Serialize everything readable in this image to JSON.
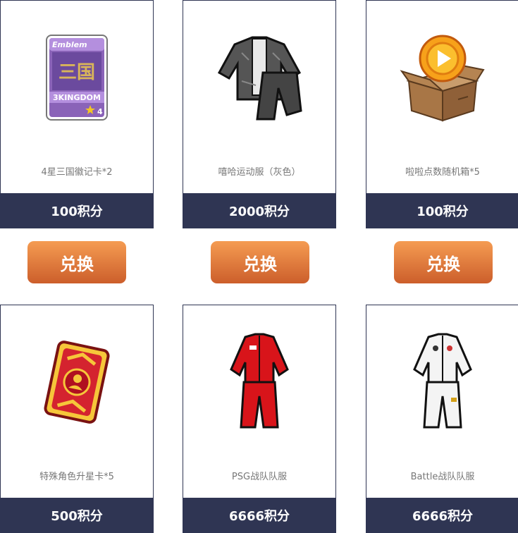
{
  "items": [
    {
      "name": "4星三国徽记卡*2",
      "price": "100积分",
      "icon": "emblem-card-icon",
      "card_text": {
        "top": "Emblem",
        "center": "三国",
        "bottom": "3KINGDOM",
        "stars": "4"
      }
    },
    {
      "name": "嘻哈运动服（灰色）",
      "price": "2000积分",
      "icon": "gray-tracksuit-icon"
    },
    {
      "name": "啦啦点数随机箱*5",
      "price": "100积分",
      "icon": "coin-box-icon"
    },
    {
      "name": "特殊角色升星卡*5",
      "price": "500积分",
      "icon": "star-up-card-icon"
    },
    {
      "name": "PSG战队队服",
      "price": "6666积分",
      "icon": "red-tracksuit-icon"
    },
    {
      "name": "Battle战队队服",
      "price": "6666积分",
      "icon": "white-tracksuit-icon"
    }
  ],
  "exchange_label": "兑换",
  "colors": {
    "price_bar": "#2f3553",
    "button_top": "#f59c52",
    "button_bottom": "#cc5e2b"
  }
}
